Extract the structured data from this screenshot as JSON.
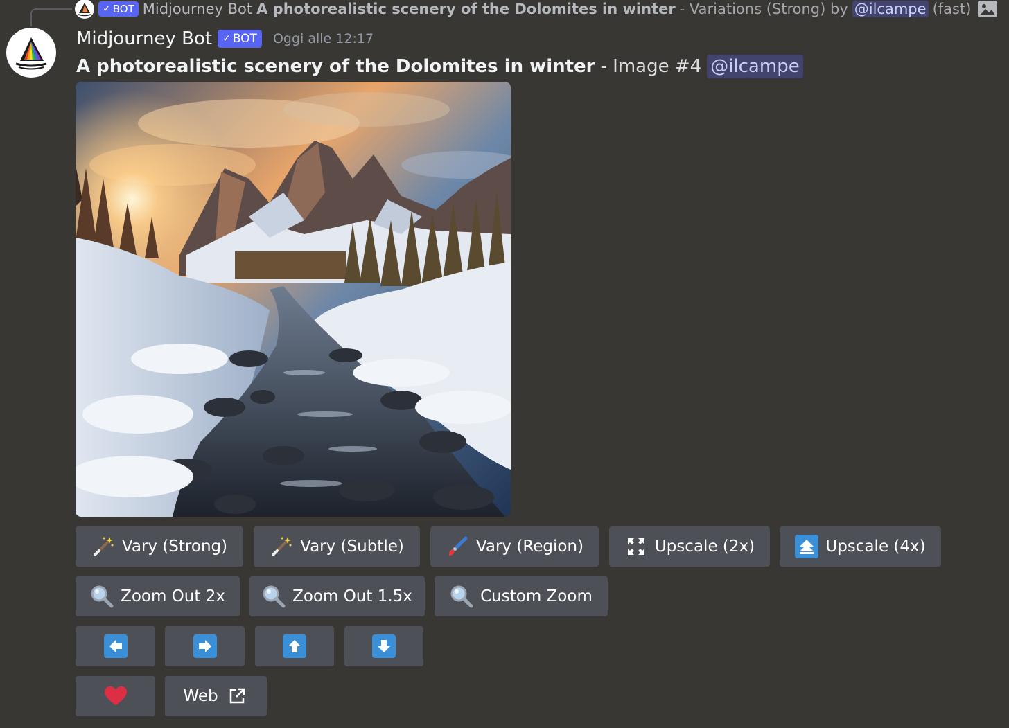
{
  "reply": {
    "bot_tag": "BOT",
    "author": "Midjourney Bot",
    "prompt": "A photorealistic scenery of the Dolomites in winter",
    "suffix": "- Variations (Strong) by",
    "mention": "@ilcampe",
    "speed": "(fast)",
    "image_icon": "image-icon"
  },
  "message": {
    "author": "Midjourney Bot",
    "bot_tag": "BOT",
    "timestamp": "Oggi alle 12:17",
    "prompt": "A photorealistic scenery of the Dolomites in winter",
    "suffix": "- Image #4",
    "mention": "@ilcampe",
    "image_subject": "Snow-covered Dolomites with a stream at sunset"
  },
  "buttons": {
    "row1": [
      {
        "label": "Vary (Strong)",
        "icon": "magic-wand-icon"
      },
      {
        "label": "Vary (Subtle)",
        "icon": "magic-wand-icon"
      },
      {
        "label": "Vary (Region)",
        "icon": "paintbrush-icon"
      },
      {
        "label": "Upscale (2x)",
        "icon": "expand-icon"
      },
      {
        "label": "Upscale (4x)",
        "icon": "double-arrow-up-icon"
      }
    ],
    "row2": [
      {
        "label": "Zoom Out 2x",
        "icon": "magnifier-icon"
      },
      {
        "label": "Zoom Out 1.5x",
        "icon": "magnifier-icon"
      },
      {
        "label": "Custom Zoom",
        "icon": "magnifier-icon"
      }
    ],
    "row3": [
      {
        "icon": "arrow-left-icon"
      },
      {
        "icon": "arrow-right-icon"
      },
      {
        "icon": "arrow-up-icon"
      },
      {
        "icon": "arrow-down-icon"
      }
    ],
    "row4": [
      {
        "icon": "heart-icon"
      },
      {
        "label": "Web",
        "icon": "external-link-icon"
      }
    ]
  },
  "colors": {
    "background": "#393734",
    "button": "#4e5058",
    "bot_tag": "#5865f2",
    "arrow_icon": "#3a8fd6",
    "heart": "#dd2e44"
  }
}
